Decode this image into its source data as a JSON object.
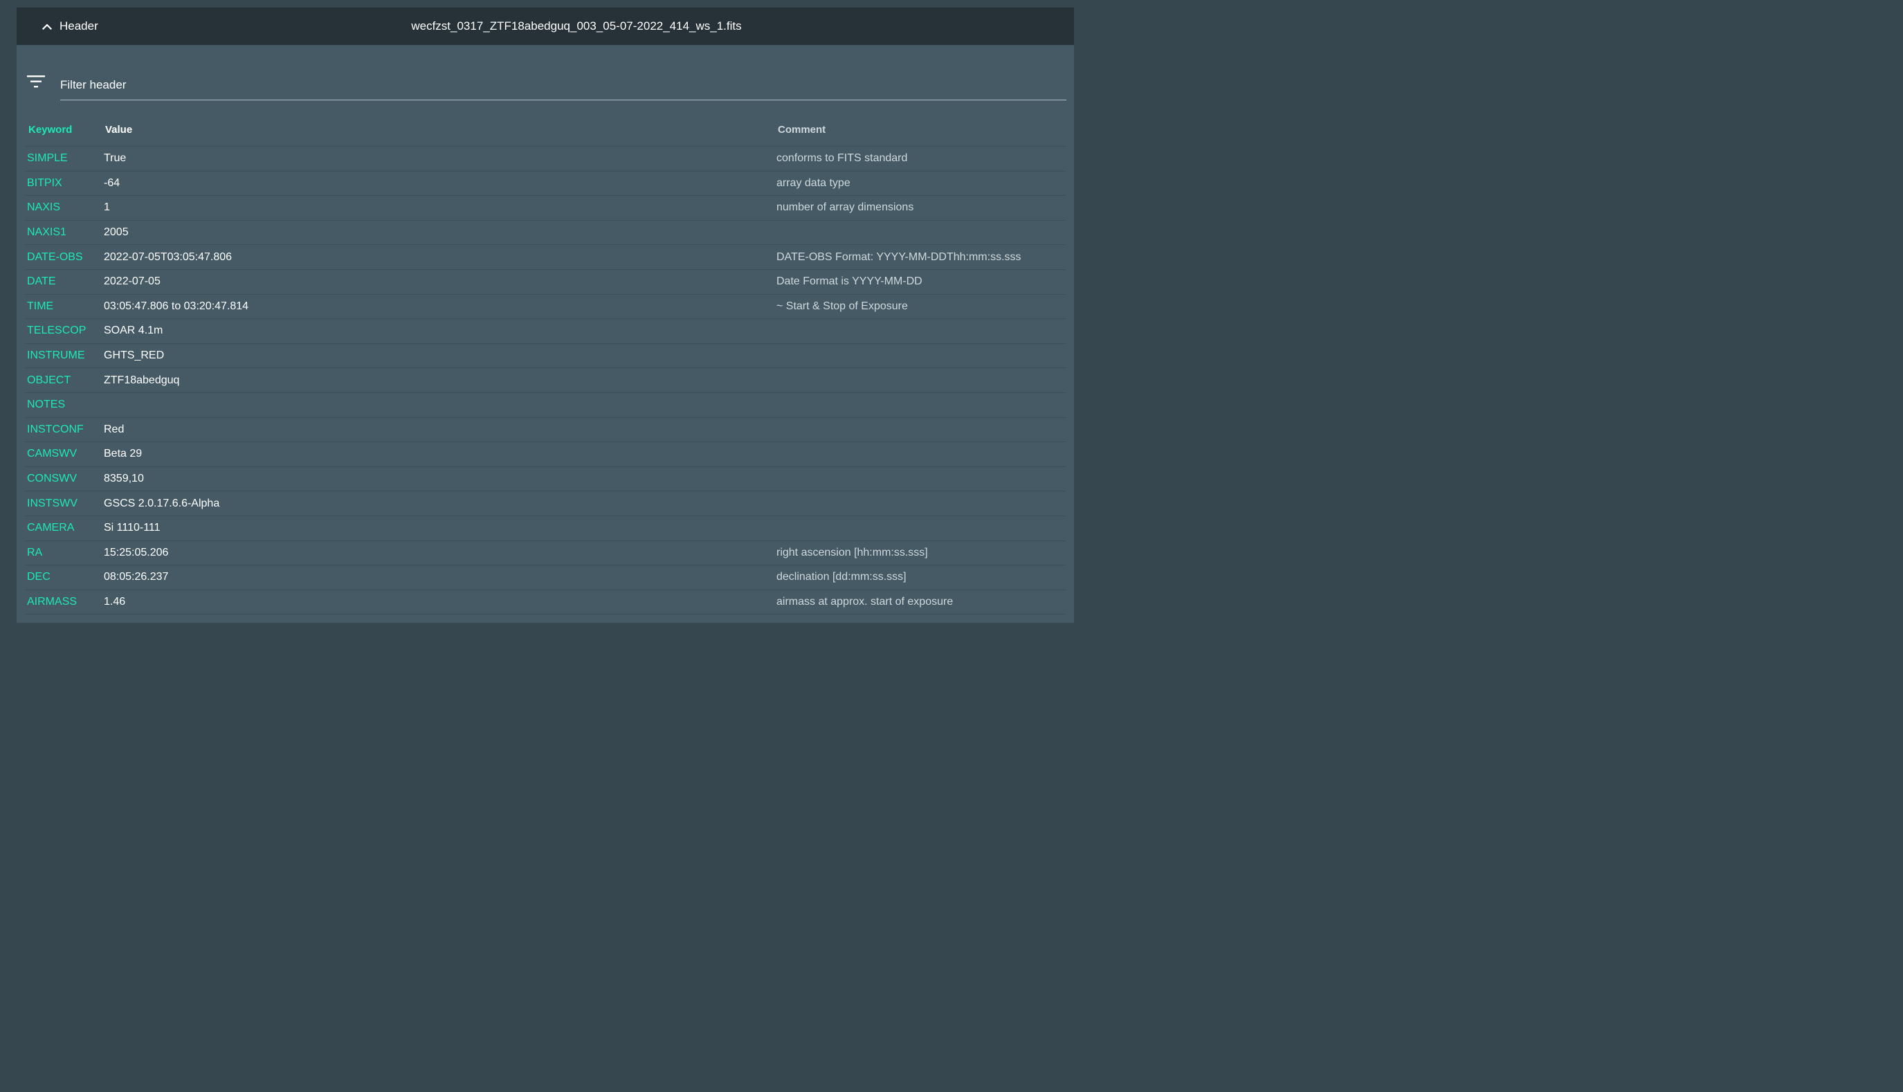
{
  "header": {
    "toggle_label": "Header",
    "file_name": "wecfzst_0317_ZTF18abedguq_003_05-07-2022_414_ws_1.fits"
  },
  "filter": {
    "placeholder": "Filter header"
  },
  "table": {
    "columns": {
      "keyword": "Keyword",
      "value": "Value",
      "comment": "Comment"
    },
    "rows": [
      {
        "keyword": "SIMPLE",
        "value": "True",
        "comment": "conforms to FITS standard"
      },
      {
        "keyword": "BITPIX",
        "value": "-64",
        "comment": "array data type"
      },
      {
        "keyword": "NAXIS",
        "value": "1",
        "comment": "number of array dimensions"
      },
      {
        "keyword": "NAXIS1",
        "value": "2005",
        "comment": ""
      },
      {
        "keyword": "DATE-OBS",
        "value": "2022-07-05T03:05:47.806",
        "comment": "DATE-OBS Format: YYYY-MM-DDThh:mm:ss.sss"
      },
      {
        "keyword": "DATE",
        "value": "2022-07-05",
        "comment": "Date Format is YYYY-MM-DD"
      },
      {
        "keyword": "TIME",
        "value": "03:05:47.806 to 03:20:47.814",
        "comment": "~ Start & Stop of Exposure"
      },
      {
        "keyword": "TELESCOP",
        "value": "SOAR 4.1m",
        "comment": ""
      },
      {
        "keyword": "INSTRUME",
        "value": "GHTS_RED",
        "comment": ""
      },
      {
        "keyword": "OBJECT",
        "value": "ZTF18abedguq",
        "comment": ""
      },
      {
        "keyword": "NOTES",
        "value": "",
        "comment": ""
      },
      {
        "keyword": "INSTCONF",
        "value": "Red",
        "comment": ""
      },
      {
        "keyword": "CAMSWV",
        "value": "Beta 29",
        "comment": ""
      },
      {
        "keyword": "CONSWV",
        "value": "8359,10",
        "comment": ""
      },
      {
        "keyword": "INSTSWV",
        "value": "GSCS 2.0.17.6.6-Alpha",
        "comment": ""
      },
      {
        "keyword": "CAMERA",
        "value": "Si 1110-111",
        "comment": ""
      },
      {
        "keyword": "RA",
        "value": "15:25:05.206",
        "comment": "right ascension [hh:mm:ss.sss]"
      },
      {
        "keyword": "DEC",
        "value": "08:05:26.237",
        "comment": "declination [dd:mm:ss.sss]"
      },
      {
        "keyword": "AIRMASS",
        "value": "1.46",
        "comment": "airmass at approx. start of exposure"
      }
    ]
  },
  "colors": {
    "page_background": "#37474f",
    "panel_background": "#455a64",
    "header_bar": "#263238",
    "keyword_accent": "#1de9b6"
  },
  "icons": {
    "toggle": "chevron-up-icon",
    "filter": "filter-list-icon"
  }
}
